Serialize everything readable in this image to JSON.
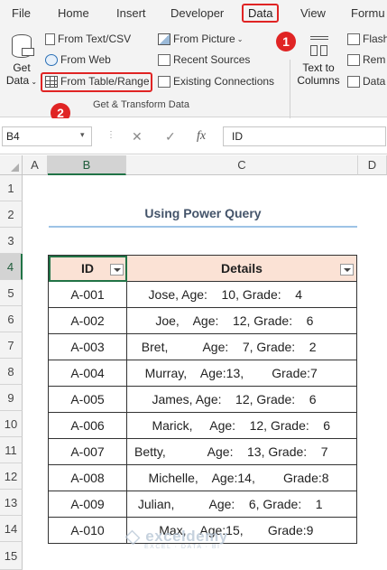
{
  "tabs": {
    "file": "File",
    "home": "Home",
    "insert": "Insert",
    "developer": "Developer",
    "data": "Data",
    "view": "View",
    "formulas": "Formu"
  },
  "ribbon": {
    "get_data_line1": "Get",
    "get_data_line2": "Data",
    "from_text_csv": "From Text/CSV",
    "from_web": "From Web",
    "from_table_range": "From Table/Range",
    "from_picture": "From Picture",
    "recent_sources": "Recent Sources",
    "existing_connections": "Existing Connections",
    "group_label": "Get & Transform Data",
    "text_to_columns_line1": "Text to",
    "text_to_columns_line2": "Columns",
    "flash": "Flash",
    "remove": "Rem",
    "data_validation": "Data"
  },
  "badges": [
    "1",
    "2"
  ],
  "formula_bar": {
    "name_box": "B4",
    "cancel": "✕",
    "enter": "✓",
    "fx": "fx",
    "value": "ID"
  },
  "columns": [
    "A",
    "B",
    "C",
    "D"
  ],
  "rows": [
    "1",
    "2",
    "3",
    "4",
    "5",
    "6",
    "7",
    "8",
    "9",
    "10",
    "11",
    "12",
    "13",
    "14",
    "15"
  ],
  "sheet": {
    "title": "Using Power Query",
    "headers": {
      "id": "ID",
      "details": "Details"
    },
    "records": [
      {
        "id": "A-001",
        "details": "    Jose, Age:    10, Grade:    4"
      },
      {
        "id": "A-002",
        "details": "      Joe,    Age:    12, Grade:    6"
      },
      {
        "id": "A-003",
        "details": "  Bret,          Age:    7, Grade:    2"
      },
      {
        "id": "A-004",
        "details": "   Murray,    Age:13,        Grade:7"
      },
      {
        "id": "A-005",
        "details": "     James, Age:    12, Grade:    6"
      },
      {
        "id": "A-006",
        "details": "     Marick,     Age:    12, Grade:    6"
      },
      {
        "id": "A-007",
        "details": "Betty,            Age:    13, Grade:    7"
      },
      {
        "id": "A-008",
        "details": "    Michelle,    Age:14,        Grade:8"
      },
      {
        "id": "A-009",
        "details": " Julian,          Age:    6, Grade:    1"
      },
      {
        "id": "A-010",
        "details": "       Max,    Age:15,       Grade:9"
      }
    ]
  },
  "watermark": {
    "name": "exceldemy",
    "tagline": "EXCEL · DATA · BI"
  },
  "colors": {
    "highlight_red": "#e02424",
    "excel_green": "#217346",
    "header_fill": "#fbe2d5"
  }
}
